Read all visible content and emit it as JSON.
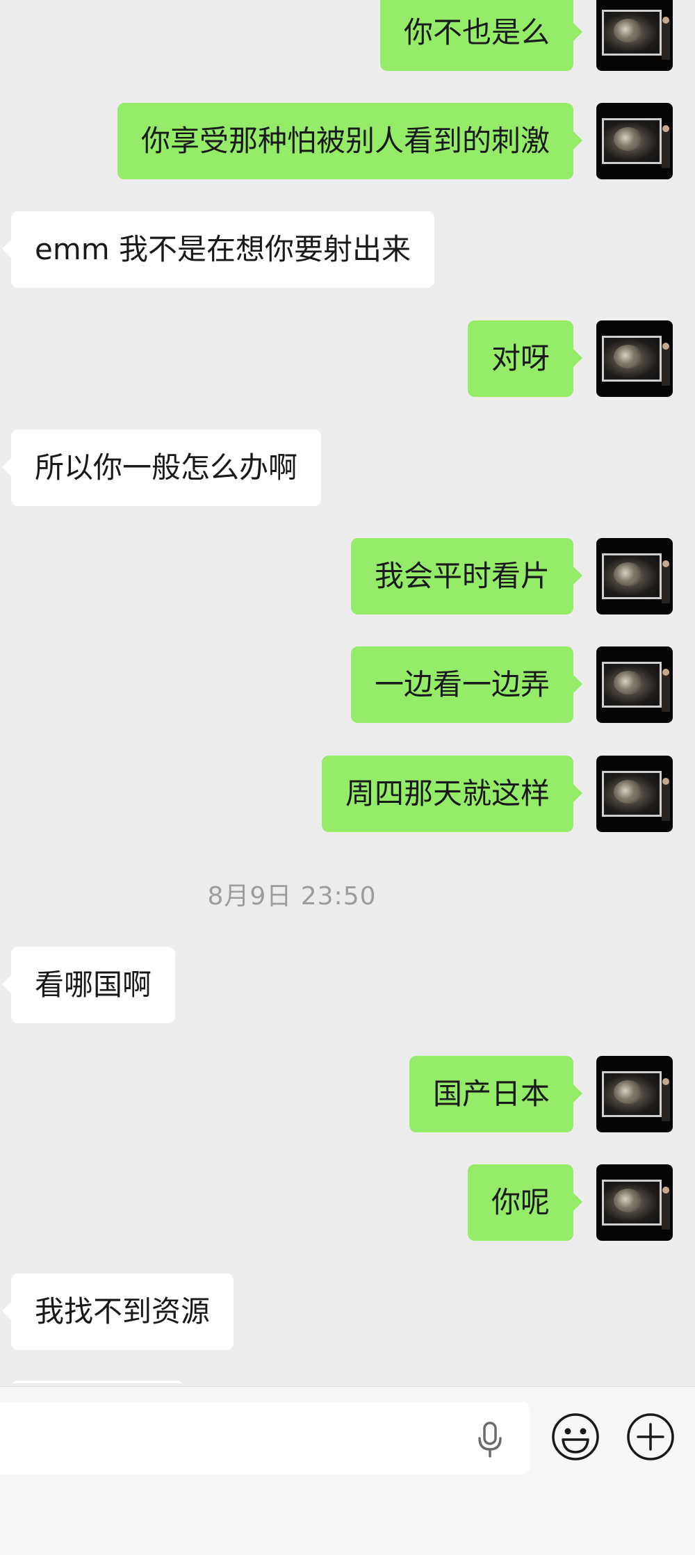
{
  "messages": [
    {
      "side": "me",
      "text": "你不也是么"
    },
    {
      "side": "me",
      "text": "你享受那种怕被别人看到的刺激"
    },
    {
      "side": "other",
      "text": "emm 我不是在想你要射出来"
    },
    {
      "side": "me",
      "text": "对呀"
    },
    {
      "side": "other",
      "text": "所以你一般怎么办啊"
    },
    {
      "side": "me",
      "text": "我会平时看片"
    },
    {
      "side": "me",
      "text": "一边看一边弄"
    },
    {
      "side": "me",
      "text": "周四那天就这样"
    },
    {
      "side": "other",
      "text": "看哪国啊"
    },
    {
      "side": "me",
      "text": "国产日本"
    },
    {
      "side": "me",
      "text": "你呢"
    },
    {
      "side": "other",
      "text": "我找不到资源"
    }
  ],
  "timestamp": "8月9日 23:50",
  "input": {
    "mic_icon": "microphone-icon",
    "emoji_icon": "smiley-icon",
    "plus_icon": "plus-icon"
  },
  "colors": {
    "background": "#ededed",
    "my_bubble": "#95ec69",
    "other_bubble": "#ffffff",
    "timestamp_text": "#9c9c9c"
  }
}
